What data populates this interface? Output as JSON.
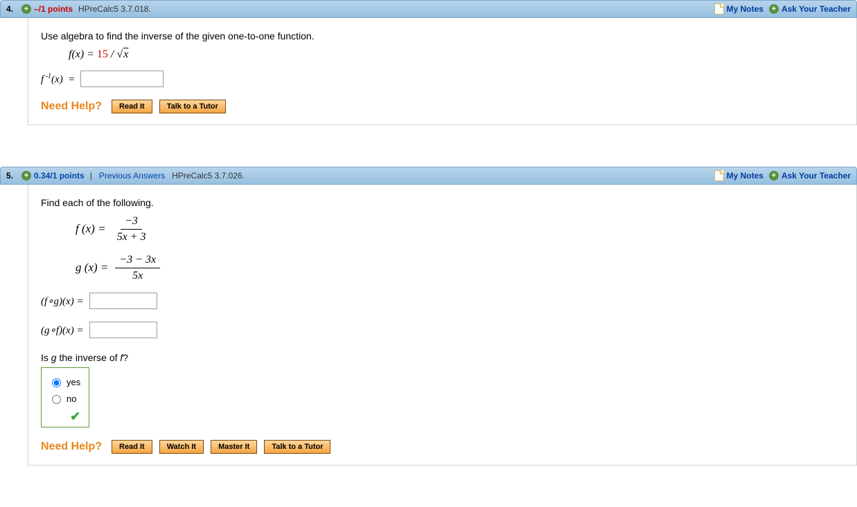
{
  "q4": {
    "number": "4.",
    "points_prefix": "–/1 points",
    "qid": "HPreCalc5 3.7.018.",
    "my_notes": "My Notes",
    "ask_teacher": "Ask Your Teacher",
    "prompt": "Use algebra to find the inverse of the given one-to-one function.",
    "formula_lhs": "f(x) = ",
    "formula_num": "15",
    "formula_div": " / ",
    "formula_sqrt_sym": "√",
    "formula_sqrt_arg": "x",
    "ans_label": "f -1(x)  =",
    "need_help": "Need Help?",
    "buttons": {
      "read": "Read It",
      "tutor": "Talk to a Tutor"
    }
  },
  "q5": {
    "number": "5.",
    "points": "0.34/1 points",
    "prev": "Previous Answers",
    "qid": "HPreCalc5 3.7.026.",
    "my_notes": "My Notes",
    "ask_teacher": "Ask Your Teacher",
    "prompt": "Find each of the following.",
    "f_lhs": "f (x) =",
    "f_top": "−3",
    "f_bot": "5x + 3",
    "g_lhs": "g (x) =",
    "g_top": "−3 − 3x",
    "g_bot": "5x",
    "fog_label": "(f∘g)(x)  =",
    "gof_label": "(g∘f)(x)  =",
    "inverse_prompt": "Is g the inverse of f?",
    "yes": "yes",
    "no": "no",
    "need_help": "Need Help?",
    "buttons": {
      "read": "Read It",
      "watch": "Watch It",
      "master": "Master It",
      "tutor": "Talk to a Tutor"
    }
  }
}
